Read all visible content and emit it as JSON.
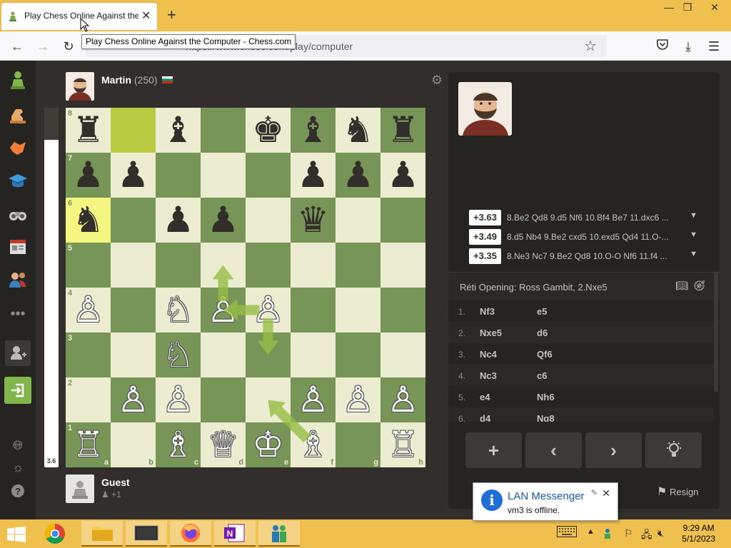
{
  "browser": {
    "tab_title": "Play Chess Online Against the",
    "tooltip": "Play Chess Online Against the Computer - Chess.com",
    "url": "https://www.chess.com/play/computer",
    "window_controls": [
      "minimize",
      "restore",
      "close"
    ]
  },
  "sidebar": {
    "items": [
      "play-icon",
      "puzzles-icon",
      "learn-icon",
      "lessons-icon",
      "watch-icon",
      "news-icon",
      "social-icon",
      "more-icon",
      "signup-icon",
      "login-icon",
      "language-icon",
      "theme-icon",
      "help-icon"
    ]
  },
  "top_player": {
    "name": "Martin",
    "rating": "(250)",
    "flag": "bulgaria-flag"
  },
  "bottom_player": {
    "name": "Guest",
    "captured": "+1"
  },
  "eval_bar": {
    "label": "3.6",
    "white_fraction": 0.91
  },
  "board": {
    "ranks": [
      "8",
      "7",
      "6",
      "5",
      "4",
      "3",
      "2",
      "1"
    ],
    "files": [
      "a",
      "b",
      "c",
      "d",
      "e",
      "f",
      "g",
      "h"
    ],
    "highlight_squares": [
      "a6",
      "b8"
    ],
    "pieces": {
      "a8": "♜",
      "c8": "♝",
      "e8": "♚",
      "f8": "♝",
      "g8": "♞",
      "h8": "♜",
      "a7": "♟",
      "b7": "♟",
      "f7": "♟",
      "g7": "♟",
      "h7": "♟",
      "a6": "♞",
      "c6": "♟",
      "d6": "♟",
      "f6": "♛",
      "a4": "♙",
      "c4": "♘",
      "d4": "♙",
      "e4": "♙",
      "c3": "♘",
      "b2": "♙",
      "c2": "♙",
      "f2": "♙",
      "g2": "♙",
      "h2": "♙",
      "a1": "♖",
      "c1": "♗",
      "d1": "♕",
      "e1": "♔",
      "f1": "♗",
      "h1": "♖"
    },
    "arrows": [
      {
        "from": "e4",
        "to": "e3"
      },
      {
        "from": "e4",
        "to": "d4"
      },
      {
        "from": "d4",
        "to": "d5"
      },
      {
        "from": "f1",
        "to": "e2"
      }
    ]
  },
  "analysis": {
    "lines": [
      {
        "score": "+3.63",
        "moves": "8.Be2 Qd8 9.d5 Nf6 10.Bf4 Be7 11.dxc6 ..."
      },
      {
        "score": "+3.49",
        "moves": "8.d5 Nb4 9.Be2 cxd5 10.exd5 Qd4 11.O-..."
      },
      {
        "score": "+3.35",
        "moves": "8.Ne3 Nc7 9.Be2 Qd8 10.O-O Nf6 11.f4 ..."
      }
    ],
    "opening": "Réti Opening: Ross Gambit, 2.Nxe5",
    "moves": [
      {
        "n": "1.",
        "w": "Nf3",
        "b": "e5"
      },
      {
        "n": "2.",
        "w": "Nxe5",
        "b": "d6"
      },
      {
        "n": "3.",
        "w": "Nc4",
        "b": "Qf6"
      },
      {
        "n": "4.",
        "w": "Nc3",
        "b": "c6"
      },
      {
        "n": "5.",
        "w": "e4",
        "b": "Nh6"
      },
      {
        "n": "6.",
        "w": "d4",
        "b": "Ng8"
      }
    ],
    "controls": [
      "+",
      "‹",
      "›",
      "hint"
    ],
    "resign": "Resign"
  },
  "notification": {
    "title": "LAN Messenger",
    "text": "vm3 is offline."
  },
  "taskbar": {
    "apps": [
      "chrome-icon",
      "file-explorer-icon",
      "terminal-icon",
      "firefox-icon",
      "onenote-icon",
      "network-app-icon"
    ],
    "time": "9:29 AM",
    "date": "5/1/2023"
  },
  "colors": {
    "light_square": "#ebecd0",
    "dark_square": "#779556",
    "arrow": "#96be46",
    "taskbar": "#f0c04f"
  }
}
